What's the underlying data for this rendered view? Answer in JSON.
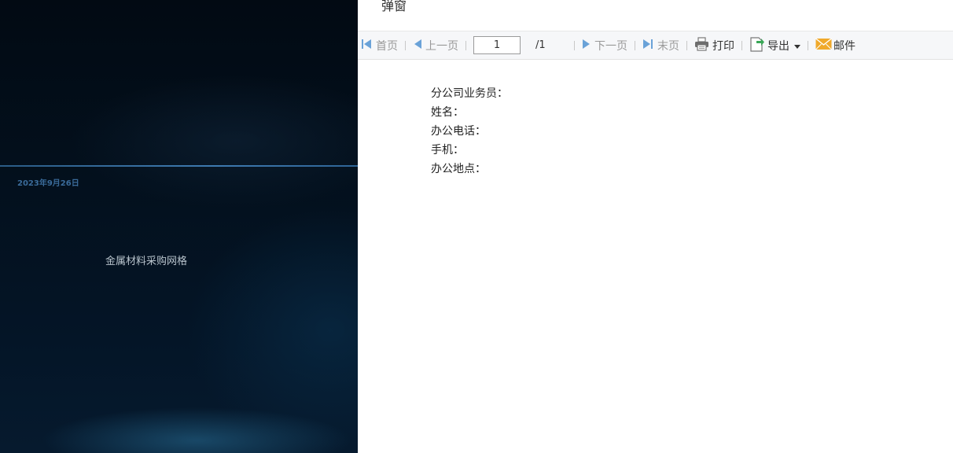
{
  "dashboard": {
    "date": "2023年9月26日",
    "caption": "金属材料采购网格"
  },
  "popup": {
    "title": "弹窗",
    "toolbar": {
      "first": "首页",
      "prev": "上一页",
      "page_value": "1",
      "page_total": "/1",
      "next": "下一页",
      "last": "末页",
      "print": "打印",
      "export": "导出",
      "mail": "邮件"
    },
    "fields": [
      "分公司业务员：",
      "姓名：",
      "办公电话：",
      "手机：",
      "办公地点："
    ]
  },
  "colors": {
    "nav_disabled_icon": "#6aa2d8",
    "export_icon_green": "#3aa757",
    "mail_icon": "#f0a92b"
  }
}
